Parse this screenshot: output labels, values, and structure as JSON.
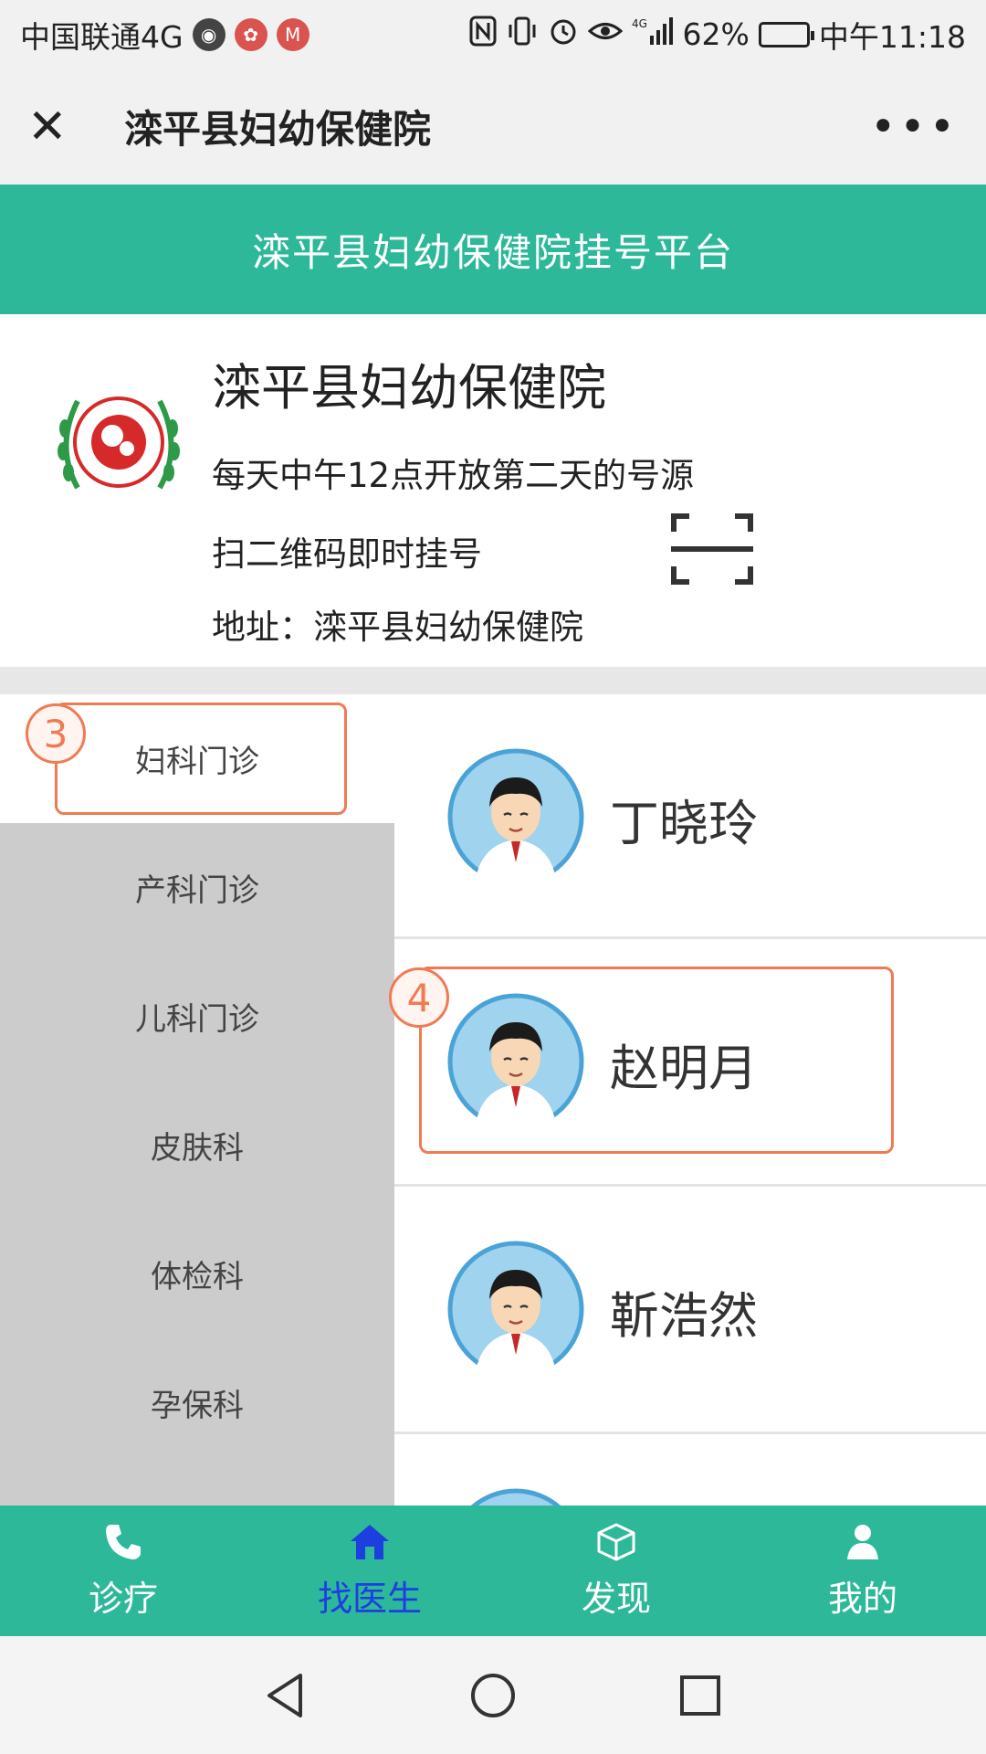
{
  "status_bar": {
    "carrier": "中国联通4G",
    "battery": "62%",
    "battery_level": 0.62,
    "time": "中午11:18"
  },
  "title_bar": {
    "title": "滦平县妇幼保健院"
  },
  "header": {
    "banner": "滦平县妇幼保健院挂号平台"
  },
  "hospital": {
    "name": "滦平县妇幼保健院",
    "notice": "每天中午12点开放第二天的号源",
    "scan_text": "扫二维码即时挂号",
    "address": "地址：滦平县妇幼保健院"
  },
  "departments": [
    {
      "label": "妇科门诊",
      "active": true
    },
    {
      "label": "产科门诊",
      "active": false
    },
    {
      "label": "儿科门诊",
      "active": false
    },
    {
      "label": "皮肤科",
      "active": false
    },
    {
      "label": "体检科",
      "active": false
    },
    {
      "label": "孕保科",
      "active": false
    }
  ],
  "doctors": [
    {
      "name": "丁晓玲"
    },
    {
      "name": "赵明月"
    },
    {
      "name": "靳浩然"
    }
  ],
  "annotations": {
    "step_3": "3",
    "step_4": "4"
  },
  "tabs": [
    {
      "label": "诊疗",
      "icon": "phone-icon",
      "active": false
    },
    {
      "label": "找医生",
      "icon": "home-icon",
      "active": true
    },
    {
      "label": "发现",
      "icon": "cube-icon",
      "active": false
    },
    {
      "label": "我的",
      "icon": "user-icon",
      "active": false
    }
  ],
  "colors": {
    "brand_green": "#2db89a",
    "active_tab": "#1d3fe0",
    "annotation": "#f07a53"
  }
}
